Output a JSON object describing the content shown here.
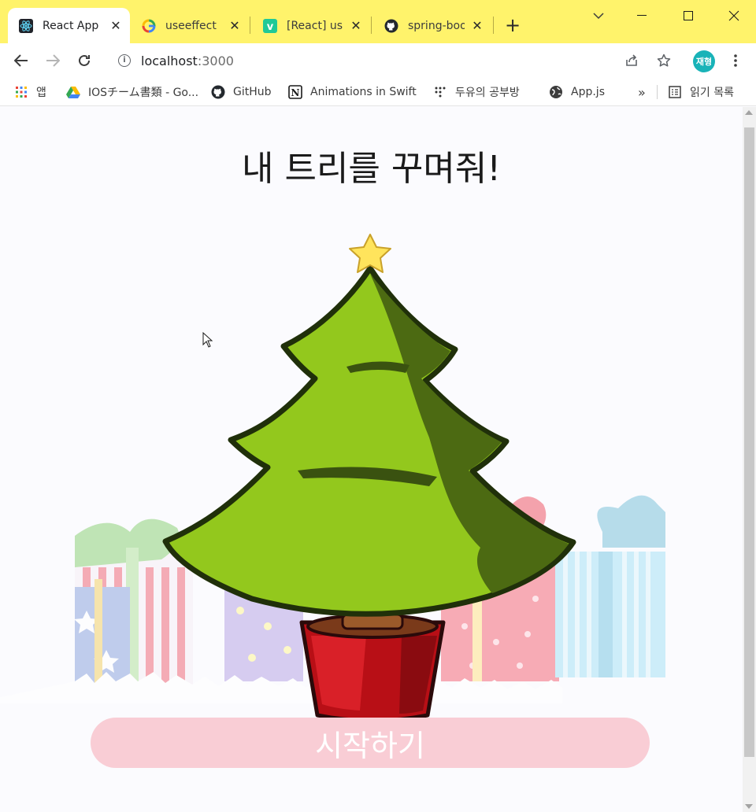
{
  "tabs": [
    {
      "title": "React App",
      "icon": "react-icon",
      "active": true
    },
    {
      "title": "useeffect",
      "icon": "google-icon",
      "active": false
    },
    {
      "title": "[React] us",
      "icon": "velog-icon",
      "active": false
    },
    {
      "title": "spring-boo",
      "icon": "github-icon",
      "active": false
    }
  ],
  "toolbar": {
    "url_host": "localhost",
    "url_port": ":3000",
    "profile_initials": "재형"
  },
  "bookmarks": [
    {
      "label": "앱",
      "icon": "apps-grid-icon"
    },
    {
      "label": "IOSチーム書類 - Go...",
      "icon": "google-drive-icon"
    },
    {
      "label": "GitHub",
      "icon": "github-icon"
    },
    {
      "label": "Animations in Swift",
      "icon": "notion-icon"
    },
    {
      "label": "두유의 공부방",
      "icon": "dots-icon"
    },
    {
      "label": "App.js",
      "icon": "globe-icon"
    }
  ],
  "bookmarks_more": "»",
  "reading_list": "읽기 목록",
  "page": {
    "title": "내 트리를 꾸며줘!",
    "start_button": "시작하기"
  },
  "colors": {
    "tab_strip": "#fff36b",
    "start_button_bg": "#f9cdd5",
    "tree_light": "#8fc81c",
    "tree_dark": "#4d6b10",
    "pot_red": "#c4161c",
    "star": "#ffe45c"
  }
}
